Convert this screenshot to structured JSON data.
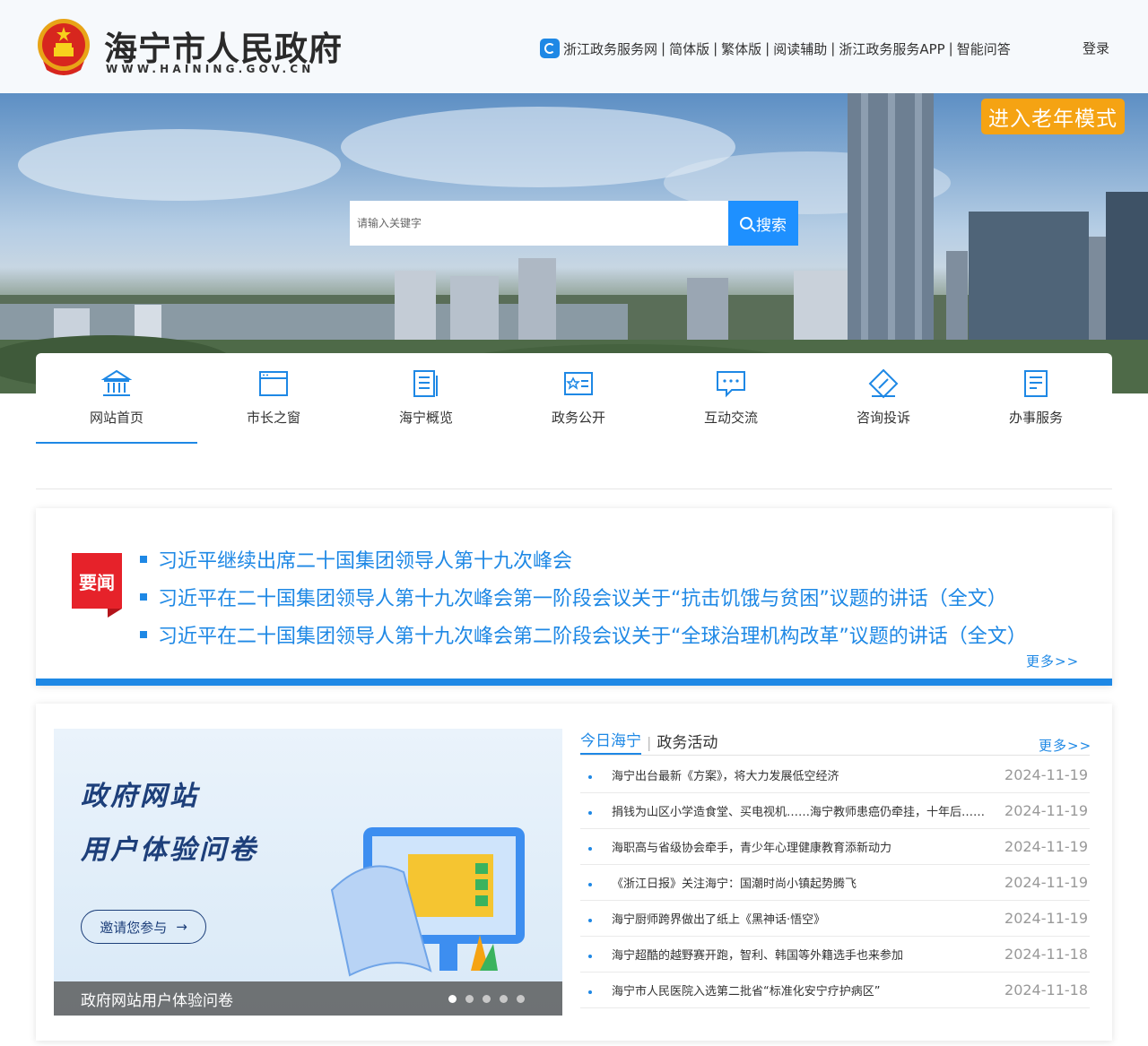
{
  "header": {
    "site_name": "海宁市人民政府",
    "site_url": "WWW.HAINING.GOV.CN",
    "links": [
      "浙江政务服务网",
      "简体版",
      "繁体版",
      "阅读辅助",
      "浙江政务服务APP",
      "智能问答"
    ],
    "link_sep": "|",
    "login": "登录"
  },
  "banner": {
    "elder_mode": "进入老年模式",
    "search_placeholder": "请输入关键字",
    "search_button": "搜索"
  },
  "nav": {
    "items": [
      {
        "label": "网站首页",
        "icon": "bank-icon"
      },
      {
        "label": "市长之窗",
        "icon": "window-icon"
      },
      {
        "label": "海宁概览",
        "icon": "document-icon"
      },
      {
        "label": "政务公开",
        "icon": "star-card-icon"
      },
      {
        "label": "互动交流",
        "icon": "chat-icon"
      },
      {
        "label": "咨询投诉",
        "icon": "pen-icon"
      },
      {
        "label": "办事服务",
        "icon": "clipboard-icon"
      }
    ]
  },
  "headlines": {
    "tag": "要闻",
    "items": [
      "习近平继续出席二十国集团领导人第十九次峰会",
      "习近平在二十国集团领导人第十九次峰会第一阶段会议关于“抗击饥饿与贫困”议题的讲话（全文）",
      "习近平在二十国集团领导人第十九次峰会第二阶段会议关于“全球治理机构改革”议题的讲话（全文）"
    ],
    "more": "更多>>"
  },
  "promo": {
    "line1": "政府网站",
    "line2": "用户体验问卷",
    "button": "邀请您参与",
    "caption": "政府网站用户体验问卷"
  },
  "news": {
    "tabs": [
      "今日海宁",
      "政务活动"
    ],
    "tab_sep": "|",
    "more": "更多>>",
    "items": [
      {
        "title": "海宁出台最新《方案》，将大力发展低空经济",
        "date": "2024-11-19"
      },
      {
        "title": "捐钱为山区小学造食堂、买电视机……海宁教师患癌仍牵挂，十年后……",
        "date": "2024-11-19"
      },
      {
        "title": "海职高与省级协会牵手，青少年心理健康教育添新动力",
        "date": "2024-11-19"
      },
      {
        "title": "《浙江日报》关注海宁：国潮时尚小镇起势腾飞",
        "date": "2024-11-19"
      },
      {
        "title": "海宁厨师跨界做出了纸上《黑神话·悟空》",
        "date": "2024-11-19"
      },
      {
        "title": "海宁超酷的越野赛开跑，智利、韩国等外籍选手也来参加",
        "date": "2024-11-18"
      },
      {
        "title": "海宁市人民医院入选第二批省“标准化安宁疗护病区”",
        "date": "2024-11-18"
      }
    ]
  },
  "colors": {
    "accent": "#1e88e5",
    "elder": "#f5a313",
    "tag_red": "#e6222a",
    "promo_text": "#1d3f7a"
  }
}
